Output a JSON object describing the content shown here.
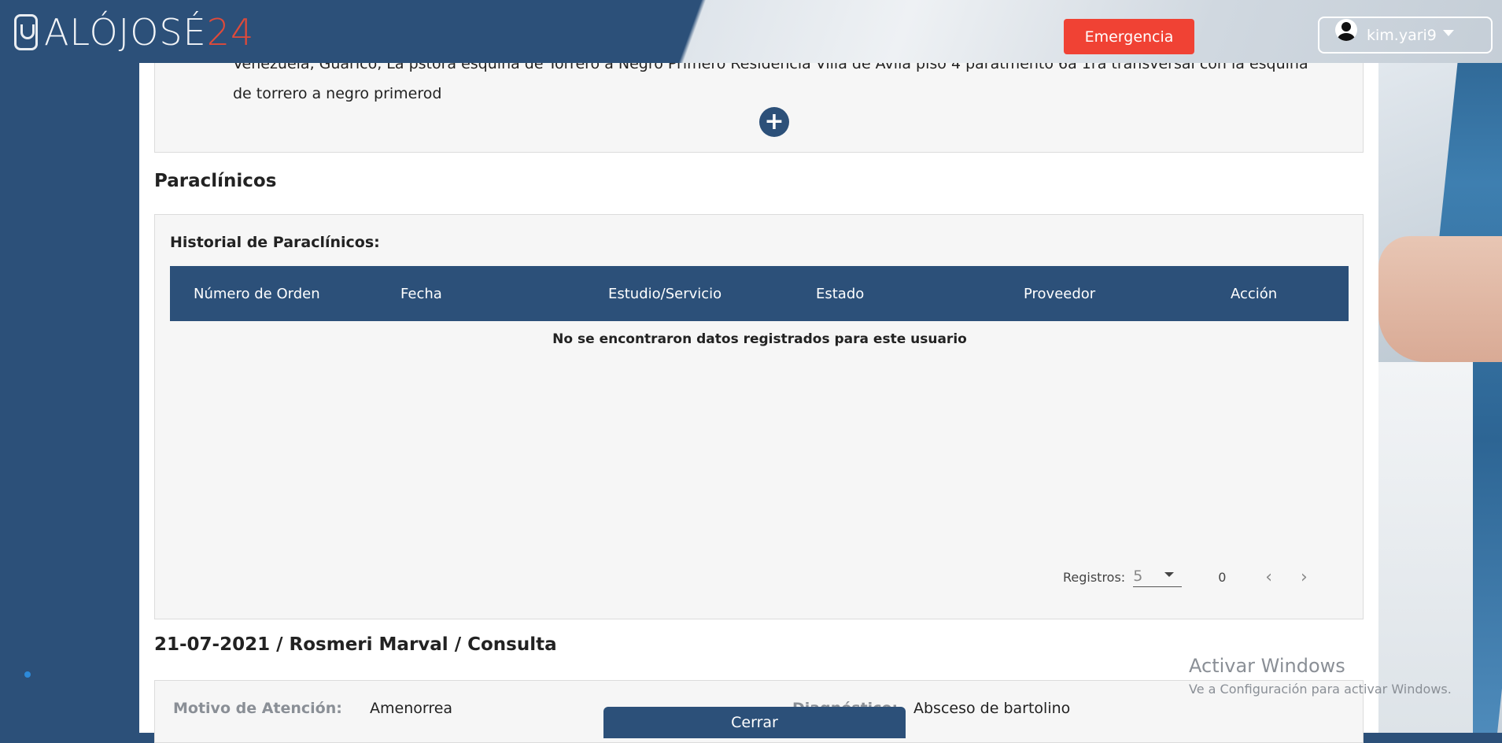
{
  "header": {
    "logo_prefix": "ALÓJOSÉ",
    "logo_suffix": "24",
    "emergency_label": "Emergencia",
    "username": "kim.yari9"
  },
  "address": {
    "text": "Venezuela, Guárico, La pstora esquina de Torrero a Negro Primero Residencia Villa de Avila piso 4 paratmento 6a 1ra transversal con la esquina de torrero a negro primerod"
  },
  "paraclinicos": {
    "section_title": "Paraclínicos",
    "subtitle": "Historial de Paraclínicos:",
    "columns": [
      "Número de Orden",
      "Fecha",
      "Estudio/Servicio",
      "Estado",
      "Proveedor",
      "Acción"
    ],
    "empty_message": "No se encontraron datos registrados para este usuario",
    "pager": {
      "label": "Registros:",
      "page_size": "5",
      "count": "0"
    }
  },
  "consulta": {
    "title": "21-07-2021 / Rosmeri Marval / Consulta",
    "motivo_label": "Motivo de Atención:",
    "motivo_value": "Amenorrea",
    "diagnostico_label": "Diagnóstico:",
    "diagnostico_value": "Absceso de bartolino"
  },
  "footer": {
    "close_label": "Cerrar"
  },
  "watermark": {
    "line1": "Activar Windows",
    "line2": "Ve a Configuración para activar Windows."
  },
  "colors": {
    "primary": "#2c5079",
    "emergency": "#f04234",
    "logo_accent": "#e04a3a"
  }
}
